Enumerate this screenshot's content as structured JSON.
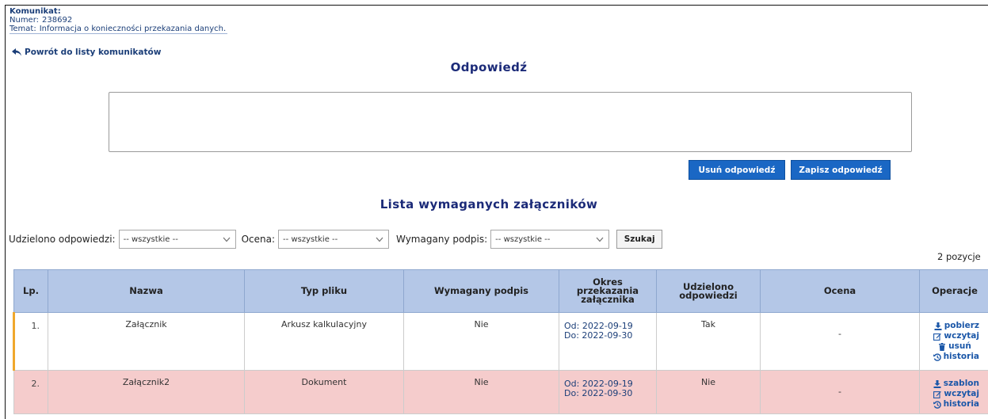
{
  "message": {
    "header_label": "Komunikat:",
    "number_label": "Numer:",
    "number_value": "238692",
    "topic_label": "Temat:",
    "topic_value": "Informacja o konieczności przekazania danych.",
    "back_link": "Powrót do listy komunikatów"
  },
  "answer": {
    "title": "Odpowiedź",
    "text": "",
    "delete_label": "Usuń odpowiedź",
    "save_label": "Zapisz odpowiedź"
  },
  "attachments": {
    "title": "Lista wymaganych załączników",
    "filters": {
      "answered_label": "Udzielono odpowiedzi:",
      "answered_value": "-- wszystkie --",
      "rating_label": "Ocena:",
      "rating_value": "-- wszystkie --",
      "signature_label": "Wymagany podpis:",
      "signature_value": "-- wszystkie --",
      "search_label": "Szukaj"
    },
    "count": "2 pozycje",
    "columns": [
      "Lp.",
      "Nazwa",
      "Typ pliku",
      "Wymagany podpis",
      "Okres przekazania załącznika",
      "Udzielono odpowiedzi",
      "Ocena",
      "Operacje"
    ],
    "rows": [
      {
        "lp": "1.",
        "name": "Załącznik",
        "type": "Arkusz kalkulacyjny",
        "signature": "Nie",
        "from_label": "Od:",
        "from": "2022-09-19",
        "to_label": "Do:",
        "to": "2022-09-30",
        "answered": "Tak",
        "rating": "-",
        "ops": [
          {
            "label": "pobierz",
            "icon": "download-icon"
          },
          {
            "label": "wczytaj",
            "icon": "edit-icon"
          },
          {
            "label": "usuń",
            "icon": "trash-icon"
          },
          {
            "label": "historia",
            "icon": "history-icon"
          }
        ]
      },
      {
        "lp": "2.",
        "name": "Załącznik2",
        "type": "Dokument",
        "signature": "Nie",
        "from_label": "Od:",
        "from": "2022-09-19",
        "to_label": "Do:",
        "to": "2022-09-30",
        "answered": "Nie",
        "rating": "-",
        "ops": [
          {
            "label": "szablon",
            "icon": "download-icon"
          },
          {
            "label": "wczytaj",
            "icon": "edit-icon"
          },
          {
            "label": "historia",
            "icon": "history-icon"
          }
        ]
      }
    ]
  },
  "colors": {
    "header_blue": "#b4c7e7",
    "button_blue": "#1a67c4",
    "row_highlight": "#f5cccc",
    "active_marker": "#f0a82c"
  }
}
